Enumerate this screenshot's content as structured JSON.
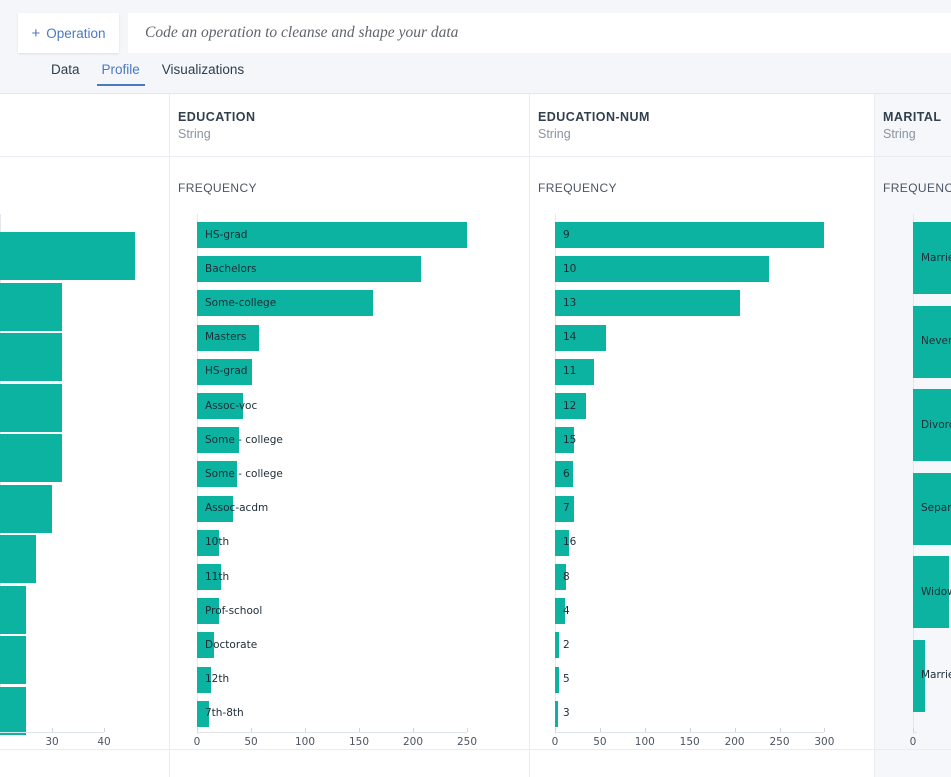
{
  "toolbar": {
    "operation_button": "Operation",
    "operation_plus": "+",
    "code_placeholder": "Code an operation to cleanse and shape your data",
    "code_value": ""
  },
  "tabs": [
    {
      "label": "Data",
      "active": false
    },
    {
      "label": "Profile",
      "active": true
    },
    {
      "label": "Visualizations",
      "active": false
    }
  ],
  "theme": {
    "bar_color": "#0cb3a0",
    "accent": "#4a79c4",
    "toolbar_bg": "#f4f6f9",
    "highlight_bg": "#f5f7fa"
  },
  "columns": [
    {
      "id": "col-scrolled",
      "name": "",
      "type": "",
      "metric": "",
      "clipped": true,
      "highlight": false
    },
    {
      "id": "col-education",
      "name": "EDUCATION",
      "type": "String",
      "metric": "FREQUENCY",
      "clipped": false,
      "highlight": false
    },
    {
      "id": "col-education-num",
      "name": "EDUCATION-NUM",
      "type": "String",
      "metric": "FREQUENCY",
      "clipped": false,
      "highlight": false
    },
    {
      "id": "col-marital",
      "name": "MARITAL",
      "type": "String",
      "metric": "FREQUENCY",
      "clipped": true,
      "highlight": true
    }
  ],
  "chart_data": [
    {
      "id": "col-scrolled",
      "type": "bar",
      "title": "",
      "orientation": "horizontal",
      "xlabel": "",
      "ylabel": "",
      "categories": [
        "",
        "",
        "",
        "",
        "",
        "",
        "",
        "",
        "",
        "",
        ""
      ],
      "values": [
        46,
        32,
        32,
        32,
        32,
        30,
        27,
        25,
        25,
        25
      ],
      "ticks": [
        30,
        40
      ],
      "xlim": [
        20,
        44
      ],
      "grid": false,
      "note": "column scrolled off left edge; labels not visible"
    },
    {
      "id": "col-education",
      "type": "bar",
      "title": "FREQUENCY",
      "orientation": "horizontal",
      "xlabel": "",
      "ylabel": "",
      "categories": [
        "HS-grad",
        "Bachelors",
        "Some-college",
        "Masters",
        "   HS-grad",
        "Assoc-voc",
        "   Some - college",
        "Some - college",
        "Assoc-acdm",
        "10th",
        "11th",
        "Prof-school",
        "Doctorate",
        "12th",
        "7th-8th"
      ],
      "values": [
        250,
        207,
        163,
        57,
        51,
        43,
        39,
        37,
        33,
        20,
        22,
        20,
        16,
        13,
        11
      ],
      "ticks": [
        0,
        50,
        100,
        150,
        200,
        250
      ],
      "xlim": [
        0,
        250
      ],
      "grid": false
    },
    {
      "id": "col-education-num",
      "type": "bar",
      "title": "FREQUENCY",
      "orientation": "horizontal",
      "xlabel": "",
      "ylabel": "",
      "categories": [
        "9",
        "10",
        "13",
        "14",
        "11",
        "12",
        "15",
        "6",
        "7",
        "16",
        "8",
        "4",
        "2",
        "5",
        "3"
      ],
      "values": [
        300,
        238,
        206,
        57,
        43,
        35,
        21,
        20,
        21,
        16,
        12,
        11,
        5,
        5,
        3
      ],
      "ticks": [
        0,
        50,
        100,
        150,
        200,
        250,
        300
      ],
      "xlim": [
        0,
        300
      ],
      "grid": false
    },
    {
      "id": "col-marital",
      "type": "bar",
      "title": "FREQUENCY",
      "orientation": "horizontal",
      "xlabel": "",
      "ylabel": "",
      "categories": [
        "Married",
        "Never-m",
        "Divorce",
        "Separat",
        "Widowe",
        "Married"
      ],
      "values": [
        300,
        280,
        260,
        160,
        120,
        40
      ],
      "ticks": [
        0
      ],
      "xlim": [
        0,
        300
      ],
      "grid": false,
      "note": "column clipped by right edge of viewport; bars and labels truncated"
    }
  ]
}
